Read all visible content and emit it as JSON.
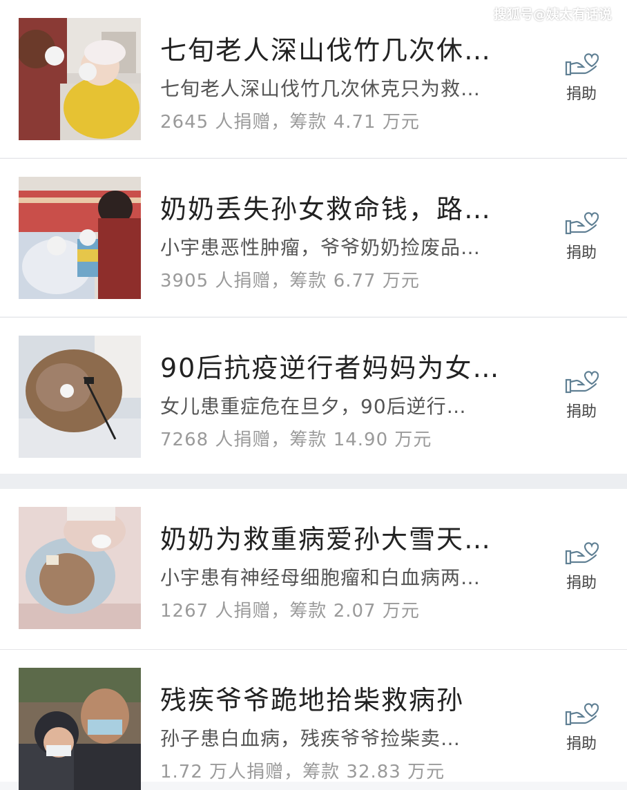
{
  "watermark": "搜狐号@姨太有话说",
  "donate_label": "捐助",
  "items": [
    {
      "title": "七旬老人深山伐竹几次休…",
      "desc": "七旬老人深山伐竹几次休克只为救…",
      "stats": "2645 人捐赠，筹款 4.71 万元"
    },
    {
      "title": "奶奶丢失孙女救命钱，路…",
      "desc": "小宇患恶性肿瘤，爷爷奶奶捡废品…",
      "stats": "3905 人捐赠，筹款 6.77 万元"
    },
    {
      "title": "90后抗疫逆行者妈妈为女…",
      "desc": "女儿患重症危在旦夕，90后逆行…",
      "stats": "7268 人捐赠，筹款 14.90 万元"
    },
    {
      "title": "奶奶为救重病爱孙大雪天…",
      "desc": "小宇患有神经母细胞瘤和白血病两…",
      "stats": "1267 人捐赠，筹款 2.07 万元"
    },
    {
      "title": "残疾爷爷跪地拾柴救病孙",
      "desc": "孙子患白血病，残疾爷爷捡柴卖…",
      "stats": "1.72 万人捐赠，筹款 32.83 万元"
    }
  ]
}
